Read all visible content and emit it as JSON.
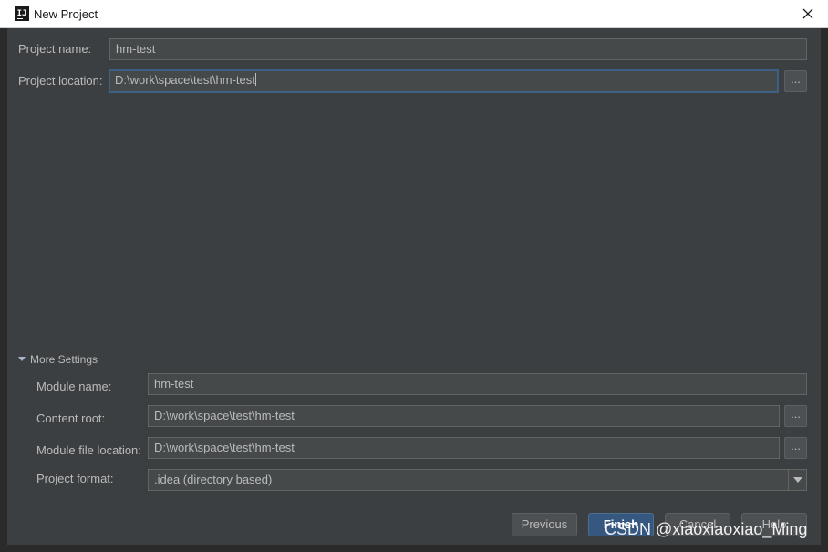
{
  "window": {
    "title": "New Project"
  },
  "project": {
    "name_label": "Project name:",
    "name_value": "hm-test",
    "location_label": "Project location:",
    "location_value": "D:\\work\\space\\test\\hm-test",
    "browse_label": "..."
  },
  "more_settings": {
    "title": "More Settings",
    "module_name_label": "Module name:",
    "module_name_value": "hm-test",
    "content_root_label": "Content root:",
    "content_root_value": "D:\\work\\space\\test\\hm-test",
    "module_file_label": "Module file location:",
    "module_file_value": "D:\\work\\space\\test\\hm-test",
    "format_label": "Project format:",
    "format_value": ".idea (directory based)",
    "browse_label": "..."
  },
  "buttons": {
    "previous": "Previous",
    "finish": "Finish",
    "cancel": "Cancel",
    "help": "Help"
  },
  "watermark": "CSDN @xiaoxiaoxiao_Ming",
  "colors": {
    "accent": "#365880",
    "focus_border": "#3d6185",
    "background": "#3c3f41"
  }
}
